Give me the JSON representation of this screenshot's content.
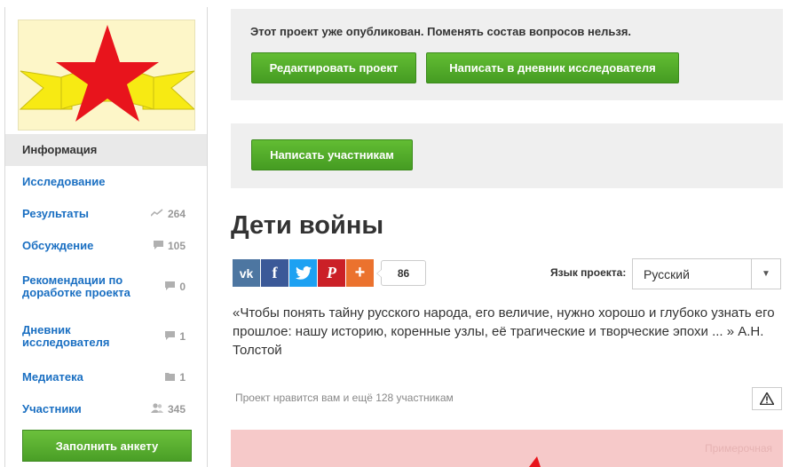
{
  "sidebar": {
    "items": [
      {
        "label": "Информация",
        "count": "",
        "icon": ""
      },
      {
        "label": "Исследование",
        "count": "",
        "icon": ""
      },
      {
        "label": "Результаты",
        "count": "264",
        "icon": "chart-icon"
      },
      {
        "label": "Обсуждение",
        "count": "105",
        "icon": "comment-icon"
      },
      {
        "label": "Рекомендации по доработке проекта",
        "count": "0",
        "icon": "comment-icon"
      },
      {
        "label": "Дневник исследователя",
        "count": "1",
        "icon": "comment-icon"
      },
      {
        "label": "Медиатека",
        "count": "1",
        "icon": "folder-icon"
      },
      {
        "label": "Участники",
        "count": "345",
        "icon": "people-icon"
      }
    ],
    "fill_button": "Заполнить анкету"
  },
  "notice": {
    "text": "Этот проект уже опубликован. Поменять состав вопросов нельзя.",
    "edit_button": "Редактировать проект",
    "diary_button": "Написать в дневник исследователя"
  },
  "participants": {
    "write_button": "Написать участникам"
  },
  "project": {
    "title": "Дети войны",
    "share_count": "86",
    "share_buttons": [
      "vk",
      "f",
      "twitter",
      "P",
      "+"
    ],
    "lang_label": "Язык проекта:",
    "lang_value": "Русский",
    "quote": "«Чтобы понять тайну русского народа, его величие, нужно хорошо и глубоко узнать его прошлое: нашу историю, коренные узлы, её трагические и творческие эпохи ... » А.Н. Толстой",
    "likes_text": "Проект нравится вам и ещё 128 участникам",
    "banner_watermark": "Примерочная"
  },
  "colors": {
    "link": "#1a6fc2",
    "green": "#4fa82a",
    "logo_star": "#e8141c",
    "logo_ribbon": "#f7ea13"
  }
}
